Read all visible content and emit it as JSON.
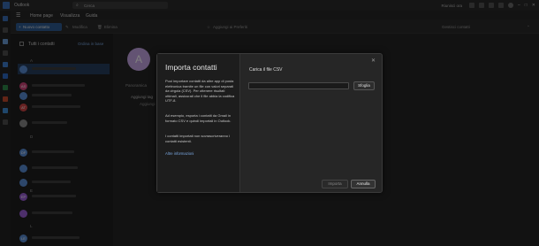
{
  "app": {
    "title": "Outlook"
  },
  "search": {
    "placeholder": "Cerca"
  },
  "titlebar_right": {
    "status_text": "Riunisci ora"
  },
  "tabs": [
    {
      "label": "Home page",
      "active": true
    },
    {
      "label": "Visualizza",
      "active": false
    },
    {
      "label": "Guida",
      "active": false
    }
  ],
  "ribbon": {
    "new_contact": "Nuovo contatto",
    "edit": "Modifica",
    "delete": "Elimina",
    "add_favorites": "Aggiungi ai Preferiti",
    "manage_contacts": "Gestisci contatti"
  },
  "contact_list": {
    "title": "Tutti i contatti",
    "sort_link": "Ordina in base",
    "group_letters": [
      "A",
      "D",
      "E",
      "L"
    ],
    "avatars": [
      {
        "initials": "",
        "color": "#5b8fd6"
      },
      {
        "initials": "AS",
        "color": "#d1457a"
      },
      {
        "initials": "",
        "color": "#5b8fd6"
      },
      {
        "initials": "AT",
        "color": "#d14545"
      },
      {
        "initials": "",
        "color": "#8a8a8a"
      },
      {
        "initials": "DF",
        "color": "#5b8fd6"
      },
      {
        "initials": "",
        "color": "#5b8fd6"
      },
      {
        "initials": "",
        "color": "#5b8fd6"
      },
      {
        "initials": "EP",
        "color": "#9b5fd6"
      },
      {
        "initials": "",
        "color": "#9b5fd6"
      },
      {
        "initials": "LE",
        "color": "#5b8fd6"
      }
    ]
  },
  "detail": {
    "avatar_letter": "A",
    "tab": "Panoramica",
    "add_label": "Aggiungi tag",
    "sub_label": "Aggiungi"
  },
  "dialog": {
    "title": "Importa contatti",
    "para1": "Puoi importare contatti da altre app di posta elettronica tramite un file con valori separati da virgola (CSV). Per ottenere risultati ottimali, assicurati che il file abbia la codifica UTF-8.",
    "para2": "Ad esempio, esporta i contatti da Gmail in formato CSV e quindi importali in Outlook.",
    "para3": "I contatti importati non sovrascriveranno i contatti esistenti.",
    "link": "Altre informazioni",
    "csv_label": "Carica il file CSV",
    "browse": "Sfoglia",
    "import_btn": "Importa",
    "cancel_btn": "Annulla"
  },
  "colors": {
    "accent": "#2f5d94",
    "link": "#7aa7e0"
  }
}
